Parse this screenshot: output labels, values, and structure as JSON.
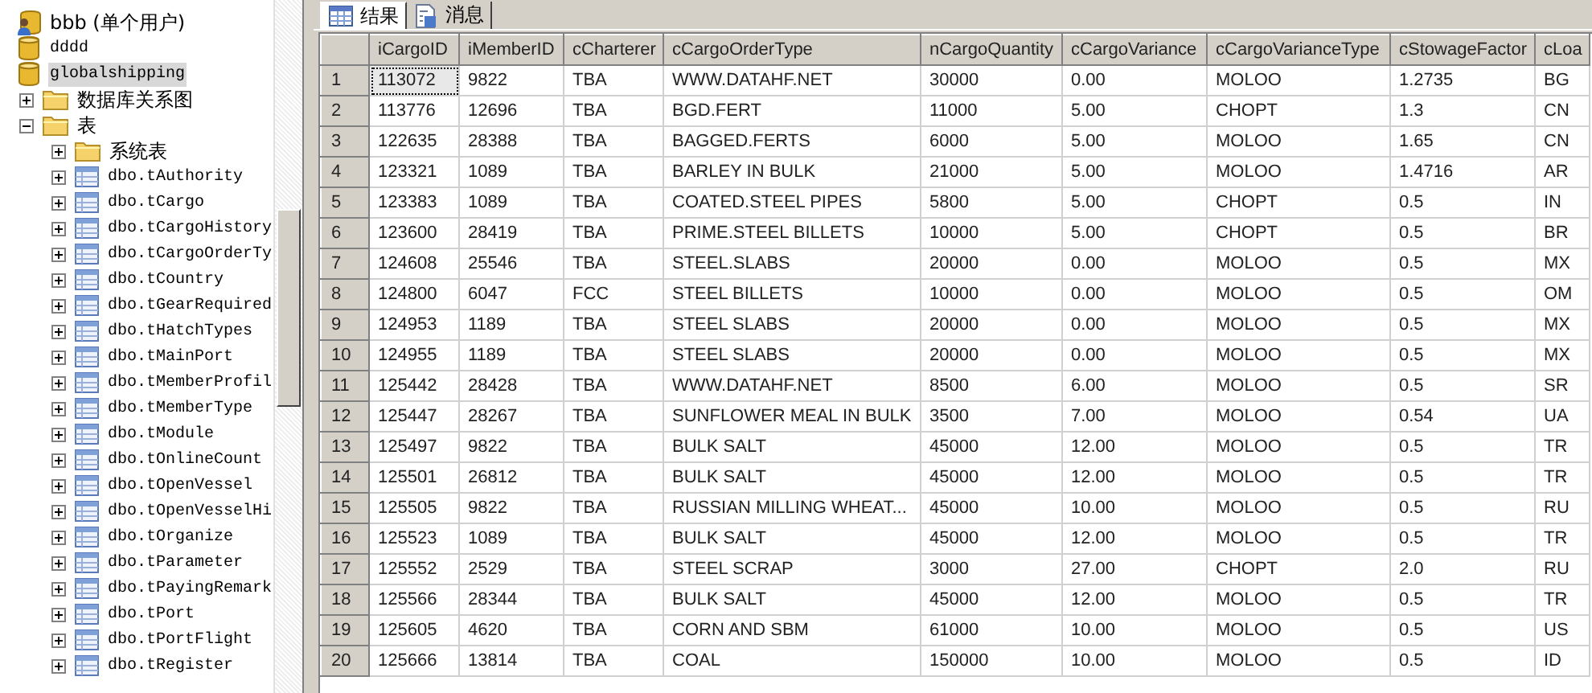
{
  "object_tree": {
    "items": [
      {
        "label": "bbb (单个用户)",
        "kind": "database-single-user",
        "selected": false
      },
      {
        "label": "dddd",
        "kind": "database",
        "selected": false
      },
      {
        "label": "globalshipping",
        "kind": "database",
        "selected": true,
        "children": [
          {
            "label": "数据库关系图",
            "kind": "folder",
            "selected": false,
            "expanded": false
          },
          {
            "label": "表",
            "kind": "folder",
            "selected": false,
            "expanded": true,
            "children": [
              {
                "label": "系统表",
                "kind": "folder",
                "selected": false,
                "expanded": false
              },
              {
                "label": "dbo.tAuthority",
                "kind": "table",
                "selected": false,
                "expanded": false
              },
              {
                "label": "dbo.tCargo",
                "kind": "table",
                "selected": false,
                "expanded": false
              },
              {
                "label": "dbo.tCargoHistory",
                "kind": "table",
                "selected": false,
                "expanded": false
              },
              {
                "label": "dbo.tCargoOrderTy",
                "kind": "table",
                "selected": false,
                "expanded": false
              },
              {
                "label": "dbo.tCountry",
                "kind": "table",
                "selected": false,
                "expanded": false
              },
              {
                "label": "dbo.tGearRequired",
                "kind": "table",
                "selected": false,
                "expanded": false
              },
              {
                "label": "dbo.tHatchTypes",
                "kind": "table",
                "selected": false,
                "expanded": false
              },
              {
                "label": "dbo.tMainPort",
                "kind": "table",
                "selected": false,
                "expanded": false
              },
              {
                "label": "dbo.tMemberProfil",
                "kind": "table",
                "selected": false,
                "expanded": false
              },
              {
                "label": "dbo.tMemberType",
                "kind": "table",
                "selected": false,
                "expanded": false
              },
              {
                "label": "dbo.tModule",
                "kind": "table",
                "selected": false,
                "expanded": false
              },
              {
                "label": "dbo.tOnlineCount",
                "kind": "table",
                "selected": false,
                "expanded": false
              },
              {
                "label": "dbo.tOpenVessel",
                "kind": "table",
                "selected": false,
                "expanded": false
              },
              {
                "label": "dbo.tOpenVesselHi",
                "kind": "table",
                "selected": false,
                "expanded": false
              },
              {
                "label": "dbo.tOrganize",
                "kind": "table",
                "selected": false,
                "expanded": false
              },
              {
                "label": "dbo.tParameter",
                "kind": "table",
                "selected": false,
                "expanded": false
              },
              {
                "label": "dbo.tPayingRemark",
                "kind": "table",
                "selected": false,
                "expanded": false
              },
              {
                "label": "dbo.tPort",
                "kind": "table",
                "selected": false,
                "expanded": false
              },
              {
                "label": "dbo.tPortFlight",
                "kind": "table",
                "selected": false,
                "expanded": false
              },
              {
                "label": "dbo.tRegister",
                "kind": "table",
                "selected": false,
                "expanded": false
              }
            ]
          }
        ]
      }
    ]
  },
  "results": {
    "tabs": [
      {
        "label": "结果",
        "kind": "grid",
        "selected": true
      },
      {
        "label": "消息",
        "kind": "messages",
        "selected": false
      }
    ],
    "table": {
      "columns": [
        "iCargoID",
        "iMemberID",
        "cCharterer",
        "cCargoOrderType",
        "nCargoQuantity",
        "cCargoVariance",
        "cCargoVarianceType",
        "cStowageFactor",
        "cLoa"
      ],
      "rows": [
        {
          "number": "1",
          "current": true,
          "cells": [
            "113072",
            "9822",
            "TBA",
            "WWW.DATAHF.NET",
            "30000",
            "0.00",
            "MOLOO",
            "1.2735",
            "BG"
          ]
        },
        {
          "number": "2",
          "current": false,
          "cells": [
            "113776",
            "12696",
            "TBA",
            "BGD.FERT",
            "11000",
            "5.00",
            "CHOPT",
            "1.3",
            "CN"
          ]
        },
        {
          "number": "3",
          "current": false,
          "cells": [
            "122635",
            "28388",
            "TBA",
            "BAGGED.FERTS",
            "6000",
            "5.00",
            "MOLOO",
            "1.65",
            "CN"
          ]
        },
        {
          "number": "4",
          "current": false,
          "cells": [
            "123321",
            "1089",
            "TBA",
            "BARLEY IN BULK",
            "21000",
            "5.00",
            "MOLOO",
            "1.4716",
            "AR"
          ]
        },
        {
          "number": "5",
          "current": false,
          "cells": [
            "123383",
            "1089",
            "TBA",
            "COATED.STEEL PIPES",
            "5800",
            "5.00",
            "CHOPT",
            "0.5",
            "IN"
          ]
        },
        {
          "number": "6",
          "current": false,
          "cells": [
            "123600",
            "28419",
            "TBA",
            "PRIME.STEEL BILLETS",
            "10000",
            "5.00",
            "CHOPT",
            "0.5",
            "BR"
          ]
        },
        {
          "number": "7",
          "current": false,
          "cells": [
            "124608",
            "25546",
            "TBA",
            "STEEL.SLABS",
            "20000",
            "0.00",
            "MOLOO",
            "0.5",
            "MX"
          ]
        },
        {
          "number": "8",
          "current": false,
          "cells": [
            "124800",
            "6047",
            "FCC",
            "STEEL BILLETS",
            "10000",
            "0.00",
            "MOLOO",
            "0.5",
            "OM"
          ]
        },
        {
          "number": "9",
          "current": false,
          "cells": [
            "124953",
            "1189",
            "TBA",
            "STEEL SLABS",
            "20000",
            "0.00",
            "MOLOO",
            "0.5",
            "MX"
          ]
        },
        {
          "number": "10",
          "current": false,
          "cells": [
            "124955",
            "1189",
            "TBA",
            "STEEL SLABS",
            "20000",
            "0.00",
            "MOLOO",
            "0.5",
            "MX"
          ]
        },
        {
          "number": "11",
          "current": false,
          "cells": [
            "125442",
            "28428",
            "TBA",
            "WWW.DATAHF.NET",
            "8500",
            "6.00",
            "MOLOO",
            "0.5",
            "SR"
          ]
        },
        {
          "number": "12",
          "current": false,
          "cells": [
            "125447",
            "28267",
            "TBA",
            "SUNFLOWER MEAL IN BULK",
            "3500",
            "7.00",
            "MOLOO",
            "0.54",
            "UA"
          ]
        },
        {
          "number": "13",
          "current": false,
          "cells": [
            "125497",
            "9822",
            "TBA",
            "BULK SALT",
            "45000",
            "12.00",
            "MOLOO",
            "0.5",
            "TR"
          ]
        },
        {
          "number": "14",
          "current": false,
          "cells": [
            "125501",
            "26812",
            "TBA",
            "BULK SALT",
            "45000",
            "12.00",
            "MOLOO",
            "0.5",
            "TR"
          ]
        },
        {
          "number": "15",
          "current": false,
          "cells": [
            "125505",
            "9822",
            "TBA",
            "RUSSIAN MILLING WHEAT...",
            "45000",
            "10.00",
            "MOLOO",
            "0.5",
            "RU"
          ]
        },
        {
          "number": "16",
          "current": false,
          "cells": [
            "125523",
            "1089",
            "TBA",
            "BULK SALT",
            "45000",
            "12.00",
            "MOLOO",
            "0.5",
            "TR"
          ]
        },
        {
          "number": "17",
          "current": false,
          "cells": [
            "125552",
            "2529",
            "TBA",
            "STEEL SCRAP",
            "3000",
            "27.00",
            "CHOPT",
            "2.0",
            "RU"
          ]
        },
        {
          "number": "18",
          "current": false,
          "cells": [
            "125566",
            "28344",
            "TBA",
            "BULK SALT",
            "45000",
            "12.00",
            "MOLOO",
            "0.5",
            "TR"
          ]
        },
        {
          "number": "19",
          "current": false,
          "cells": [
            "125605",
            "4620",
            "TBA",
            "CORN AND SBM",
            "61000",
            "10.00",
            "MOLOO",
            "0.5",
            "US"
          ]
        },
        {
          "number": "20",
          "current": false,
          "cells": [
            "125666",
            "13814",
            "TBA",
            "COAL",
            "150000",
            "10.00",
            "MOLOO",
            "0.5",
            "ID"
          ]
        }
      ]
    }
  }
}
